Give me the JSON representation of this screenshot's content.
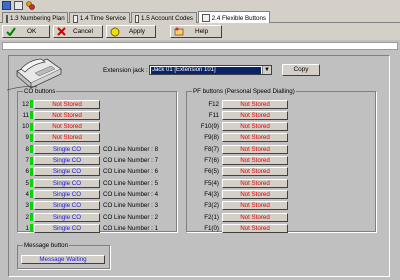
{
  "tabs": [
    {
      "label": "1.3 Numbering Plan",
      "active": false
    },
    {
      "label": "1.4 Time Service",
      "active": false
    },
    {
      "label": "1.5 Account Codes",
      "active": false
    },
    {
      "label": "2.4 Flexible Buttons",
      "active": true
    }
  ],
  "toolbar": {
    "ok_label": "OK",
    "cancel_label": "Cancel",
    "apply_label": "Apply",
    "help_label": "Help"
  },
  "extension": {
    "label": "Extension jack :",
    "selected": "Jack 01 [Extension 101]",
    "copy_label": "Copy"
  },
  "co_buttons": {
    "title": "CO buttons",
    "rows": [
      {
        "num": "12",
        "label": "Not Stored",
        "state": "not-stored",
        "line": ""
      },
      {
        "num": "11",
        "label": "Not Stored",
        "state": "not-stored",
        "line": ""
      },
      {
        "num": "10",
        "label": "Not Stored",
        "state": "not-stored",
        "line": ""
      },
      {
        "num": "9",
        "label": "Not Stored",
        "state": "not-stored",
        "line": ""
      },
      {
        "num": "8",
        "label": "Single CO",
        "state": "stored",
        "line": "CO Line Number : 8"
      },
      {
        "num": "7",
        "label": "Single CO",
        "state": "stored",
        "line": "CO Line Number : 7"
      },
      {
        "num": "6",
        "label": "Single CO",
        "state": "stored",
        "line": "CO Line Number : 6"
      },
      {
        "num": "5",
        "label": "Single CO",
        "state": "stored",
        "line": "CO Line Number : 5"
      },
      {
        "num": "4",
        "label": "Single CO",
        "state": "stored",
        "line": "CO Line Number : 4"
      },
      {
        "num": "3",
        "label": "Single CO",
        "state": "stored",
        "line": "CO Line Number : 3"
      },
      {
        "num": "2",
        "label": "Single CO",
        "state": "stored",
        "line": "CO Line Number : 2"
      },
      {
        "num": "1",
        "label": "Single CO",
        "state": "stored",
        "line": "CO Line Number : 1"
      }
    ]
  },
  "pf_buttons": {
    "title": "PF buttons (Personal Speed Dialling)",
    "rows": [
      {
        "num": "F12",
        "label": "Not Stored"
      },
      {
        "num": "F11",
        "label": "Not Stored"
      },
      {
        "num": "F10(9)",
        "label": "Not Stored"
      },
      {
        "num": "F9(8)",
        "label": "Not Stored"
      },
      {
        "num": "F8(7)",
        "label": "Not Stored"
      },
      {
        "num": "F7(6)",
        "label": "Not Stored"
      },
      {
        "num": "F6(5)",
        "label": "Not Stored"
      },
      {
        "num": "F5(4)",
        "label": "Not Stored"
      },
      {
        "num": "F4(3)",
        "label": "Not Stored"
      },
      {
        "num": "F3(2)",
        "label": "Not Stored"
      },
      {
        "num": "F2(1)",
        "label": "Not Stored"
      },
      {
        "num": "F1(0)",
        "label": "Not Stored"
      }
    ]
  },
  "message_button": {
    "title": "Message button",
    "label": "Message Waiting"
  },
  "colors": {
    "not_stored": "#e00000",
    "stored": "#1b1bd8",
    "indicator": "#00d800",
    "selection": "#0a246a"
  }
}
